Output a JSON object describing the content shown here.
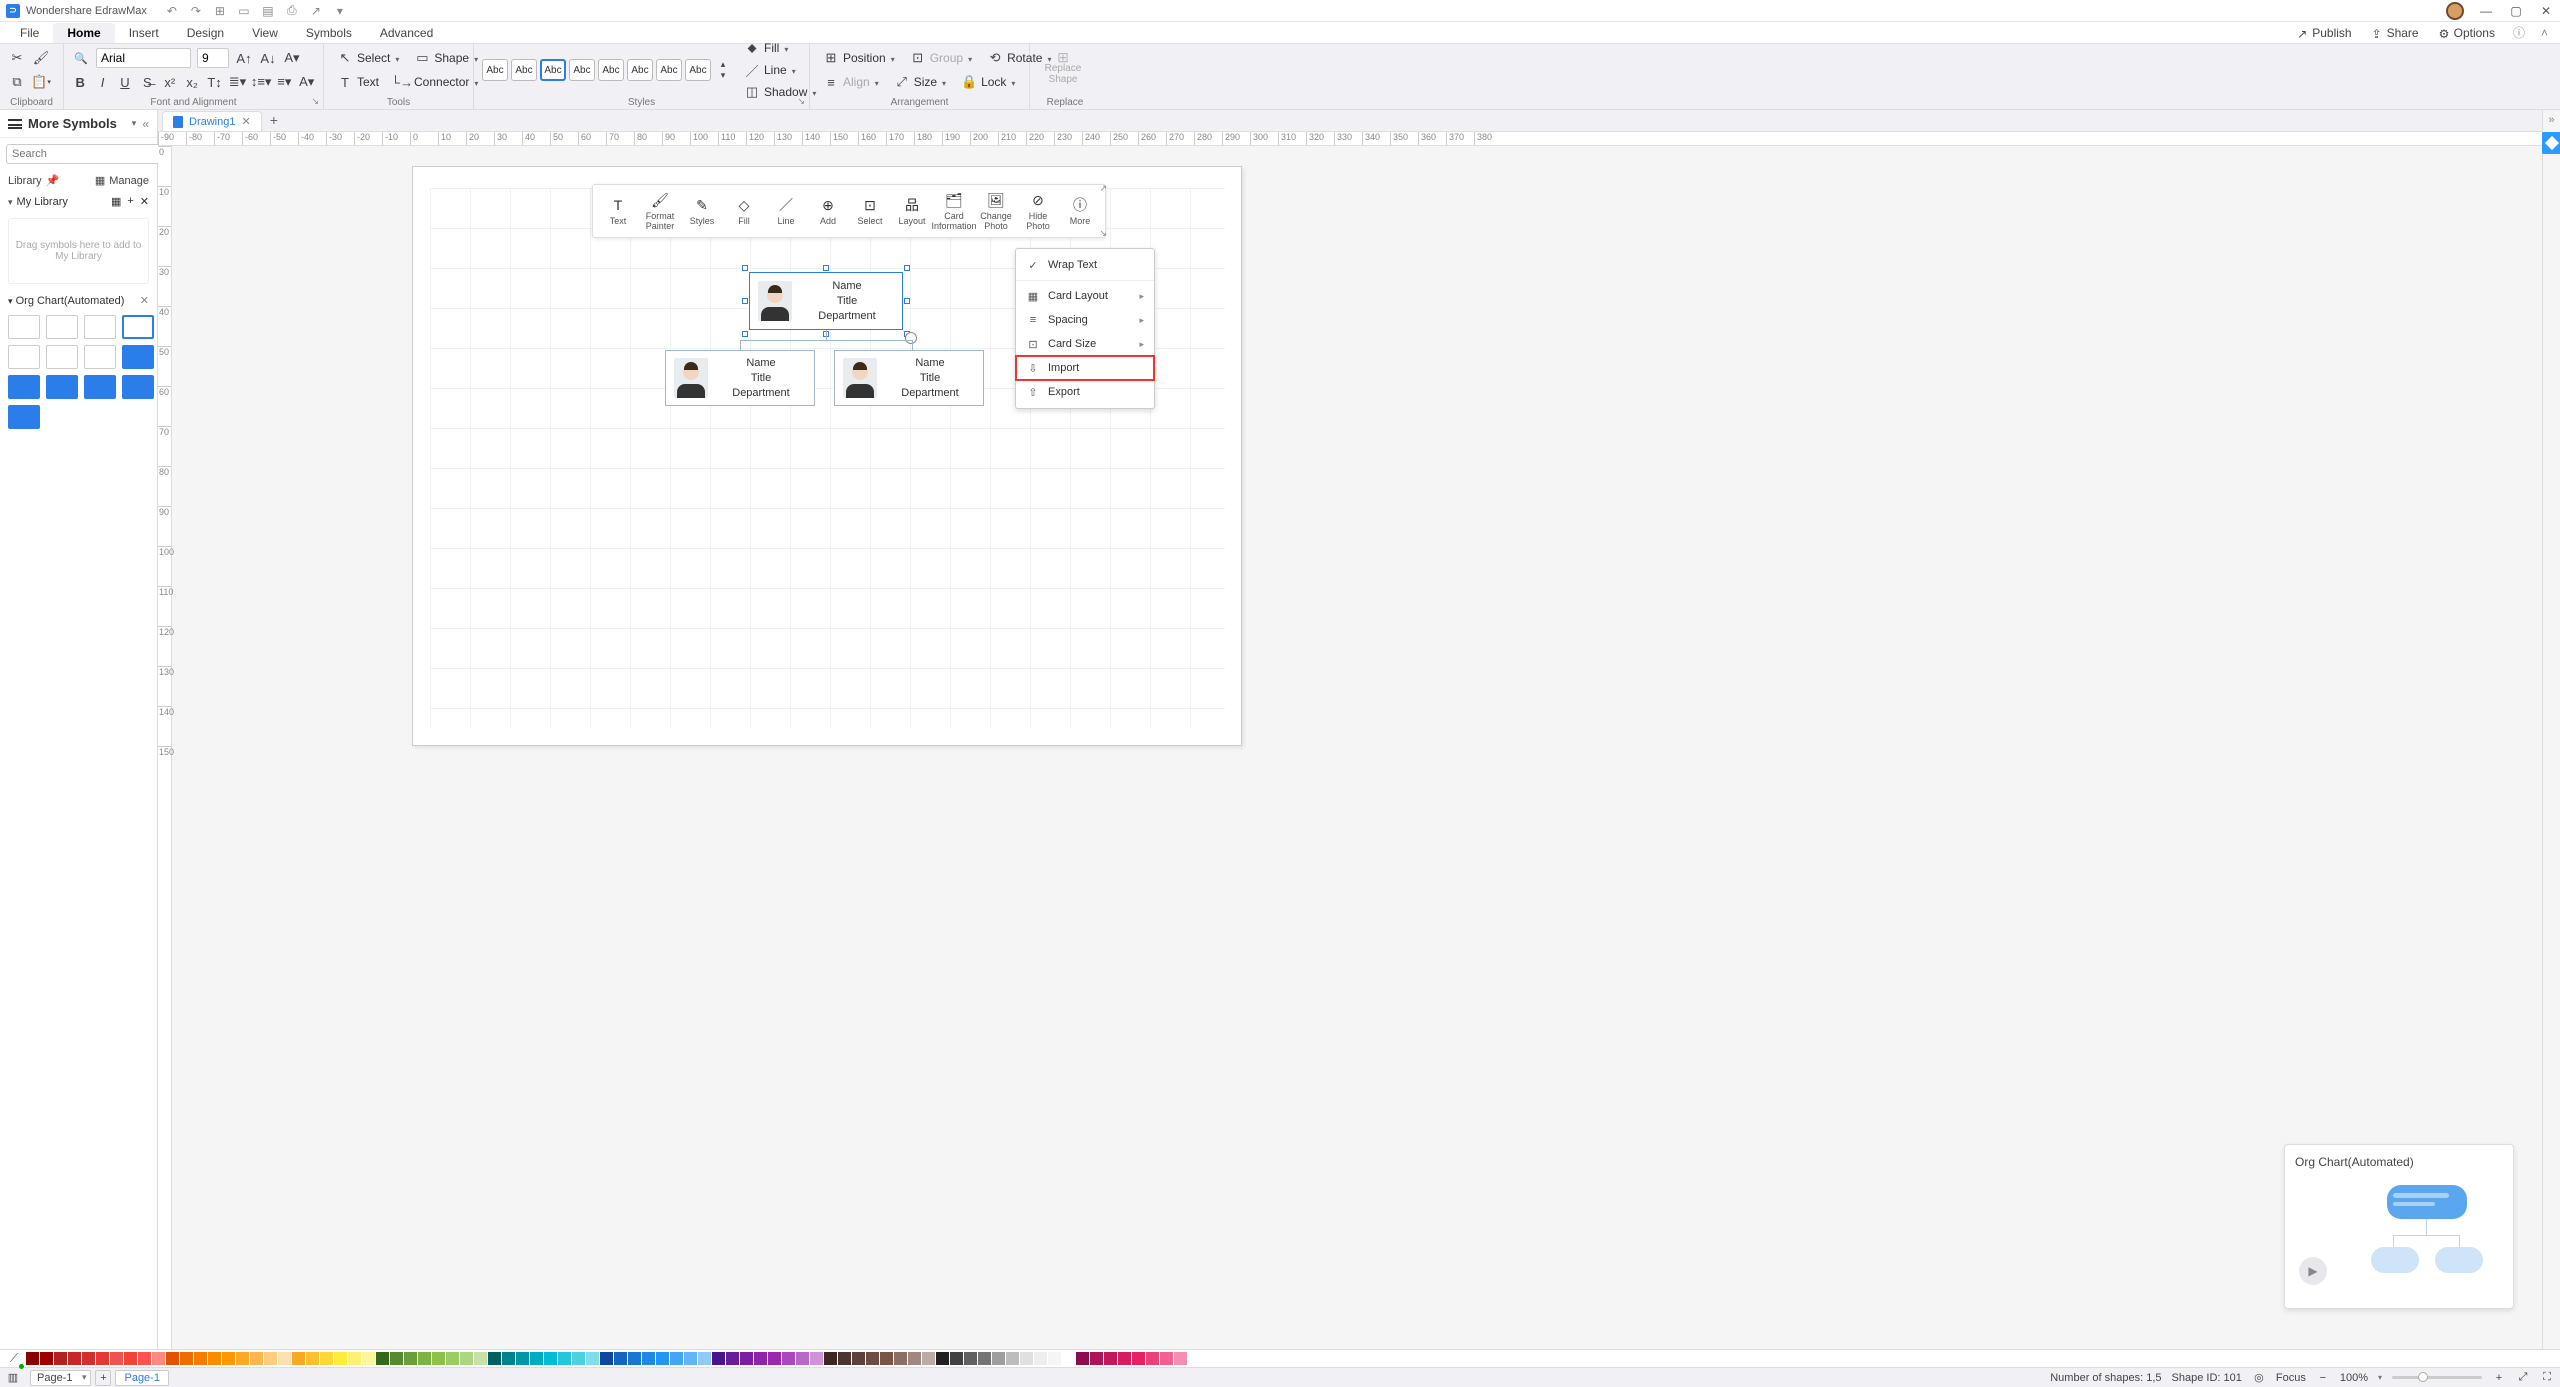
{
  "app": {
    "title": "Wondershare EdrawMax"
  },
  "menubar": {
    "items": [
      "File",
      "Home",
      "Insert",
      "Design",
      "View",
      "Symbols",
      "Advanced"
    ],
    "active_index": 1,
    "right": {
      "publish": "Publish",
      "share": "Share",
      "options": "Options"
    }
  },
  "ribbon": {
    "clipboard": {
      "label": "Clipboard"
    },
    "font": {
      "label": "Font and Alignment",
      "name": "Arial",
      "size": "9"
    },
    "tools": {
      "label": "Tools",
      "select": "Select",
      "shape": "Shape",
      "text": "Text",
      "connector": "Connector"
    },
    "styles": {
      "label": "Styles",
      "swatch_text": "Abc",
      "fill": "Fill",
      "line": "Line",
      "shadow": "Shadow"
    },
    "arrangement": {
      "label": "Arrangement",
      "position": "Position",
      "group": "Group",
      "rotate": "Rotate",
      "align": "Align",
      "size": "Size",
      "lock": "Lock"
    },
    "replace": {
      "label": "Replace",
      "btn": "Replace Shape"
    }
  },
  "left_panel": {
    "title": "More Symbols",
    "search_placeholder": "Search",
    "search_btn": "Search",
    "library": "Library",
    "manage": "Manage",
    "my_library": "My Library",
    "dropzone": "Drag symbols here to add to My Library",
    "category": "Org Chart(Automated)"
  },
  "tabs": {
    "doc": "Drawing1"
  },
  "hruler_ticks": [
    "-90",
    "-80",
    "-70",
    "-60",
    "-50",
    "-40",
    "-30",
    "-20",
    "-10",
    "0",
    "10",
    "20",
    "30",
    "40",
    "50",
    "60",
    "70",
    "80",
    "90",
    "100",
    "110",
    "120",
    "130",
    "140",
    "150",
    "160",
    "170",
    "180",
    "190",
    "200",
    "210",
    "220",
    "230",
    "240",
    "250",
    "260",
    "270",
    "280",
    "290",
    "300",
    "310",
    "320",
    "330",
    "340",
    "350",
    "360",
    "370",
    "380"
  ],
  "vruler_ticks": [
    "0",
    "10",
    "20",
    "30",
    "40",
    "50",
    "60",
    "70",
    "80",
    "90",
    "100",
    "110",
    "120",
    "130",
    "140",
    "150"
  ],
  "ctx_toolbar": {
    "items": [
      "Text",
      "Format Painter",
      "Styles",
      "Fill",
      "Line",
      "Add",
      "Select",
      "Layout",
      "Card Information",
      "Change Photo",
      "Hide Photo",
      "More"
    ]
  },
  "ctx_menu": {
    "wrap": "Wrap Text",
    "card_layout": "Card Layout",
    "spacing": "Spacing",
    "card_size": "Card Size",
    "import": "Import",
    "export": "Export"
  },
  "org": {
    "name": "Name",
    "title_field": "Title",
    "dept": "Department"
  },
  "preview": {
    "title": "Org Chart(Automated)"
  },
  "statusbar": {
    "page_sel": "Page-1",
    "page_tab": "Page-1",
    "shapes": "Number of shapes: 1,5",
    "shape_id": "Shape ID: 101",
    "focus": "Focus",
    "zoom": "100%"
  },
  "colors": [
    "#000000",
    "#c00000",
    "#e06666",
    "#e69138",
    "#f1c232",
    "#6aa84f",
    "#45818e",
    "#3d85c6",
    "#674ea7",
    "#a64d79",
    "#999999",
    "#ffffff"
  ]
}
